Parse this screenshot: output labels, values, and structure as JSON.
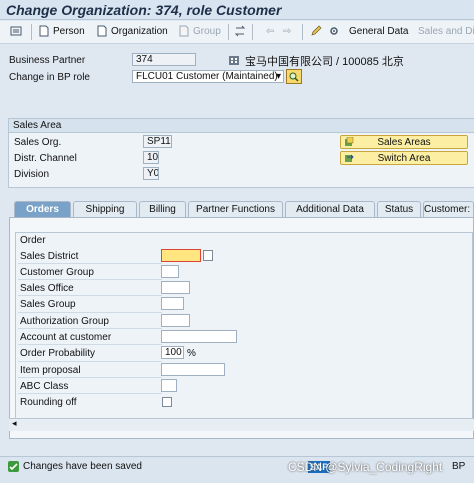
{
  "window": {
    "title": "Change Organization: 374, role Customer"
  },
  "toolbar": {
    "person": "Person",
    "organization": "Organization",
    "group": "Group",
    "general_data": "General Data",
    "sales_and_dist": "Sales and Di"
  },
  "header": {
    "bp_label": "Business Partner",
    "bp_value": "374",
    "bp_desc": "宝马中国有限公司 / 100085 北京",
    "role_label": "Change in BP role",
    "role_value": "FLCU01 Customer (Maintained)"
  },
  "sales_area": {
    "title": "Sales Area",
    "org_label": "Sales Org.",
    "org_value": "SP11",
    "channel_label": "Distr. Channel",
    "channel_value": "10",
    "division_label": "Division",
    "division_value": "Y0",
    "btn_sales_areas": "Sales Areas",
    "btn_switch_area": "Switch Area"
  },
  "tabs": [
    "Orders",
    "Shipping",
    "Billing",
    "Partner Functions",
    "Additional Data",
    "Status",
    "Customer: Te"
  ],
  "order": {
    "title": "Order",
    "fields": [
      {
        "label": "Sales District",
        "value": ""
      },
      {
        "label": "Customer Group",
        "value": ""
      },
      {
        "label": "Sales Office",
        "value": ""
      },
      {
        "label": "Sales Group",
        "value": ""
      },
      {
        "label": "Authorization Group",
        "value": ""
      },
      {
        "label": "Account at customer",
        "value": ""
      },
      {
        "label": "Order Probability",
        "value": "100",
        "unit": "%"
      },
      {
        "label": "Item proposal",
        "value": ""
      },
      {
        "label": "ABC Class",
        "value": ""
      },
      {
        "label": "Rounding off",
        "value": ""
      }
    ]
  },
  "status": {
    "message": "Changes have been saved",
    "system": "BP"
  },
  "watermark": {
    "text": "CSDN @Sylvia_CodingRight",
    "logo": "SAP"
  },
  "colors": {
    "accent": "#7aa2c8",
    "button": "#fcefa4",
    "active_field": "#ffe680"
  }
}
